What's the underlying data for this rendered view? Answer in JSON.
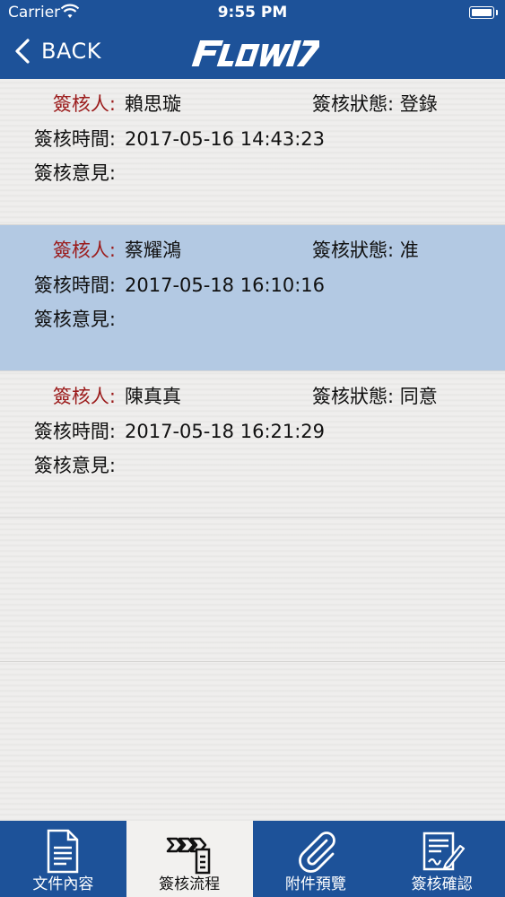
{
  "status_bar": {
    "carrier": "Carrier",
    "time": "9:55 PM"
  },
  "nav": {
    "back_label": "BACK",
    "logo_text": "Flow 17"
  },
  "labels": {
    "approver": "簽核人:",
    "status": "簽核狀態:",
    "time": "簽核時間:",
    "opinion": "簽核意見:"
  },
  "records": [
    {
      "approver": "賴思璇",
      "status": "登錄",
      "time": "2017-05-16 14:43:23",
      "opinion": ""
    },
    {
      "approver": "蔡耀鴻",
      "status": "准",
      "time": "2017-05-18 16:10:16",
      "opinion": ""
    },
    {
      "approver": "陳真真",
      "status": "同意",
      "time": "2017-05-18 16:21:29",
      "opinion": ""
    }
  ],
  "tabs": [
    {
      "label": "文件內容",
      "icon": "document-icon"
    },
    {
      "label": "簽核流程",
      "icon": "workflow-icon"
    },
    {
      "label": "附件預覽",
      "icon": "paperclip-icon"
    },
    {
      "label": "簽核確認",
      "icon": "sign-confirm-icon"
    }
  ],
  "colors": {
    "brand": "#1d5299",
    "selected_row": "#b3c9e3",
    "approver_label": "#9b1b1b"
  }
}
